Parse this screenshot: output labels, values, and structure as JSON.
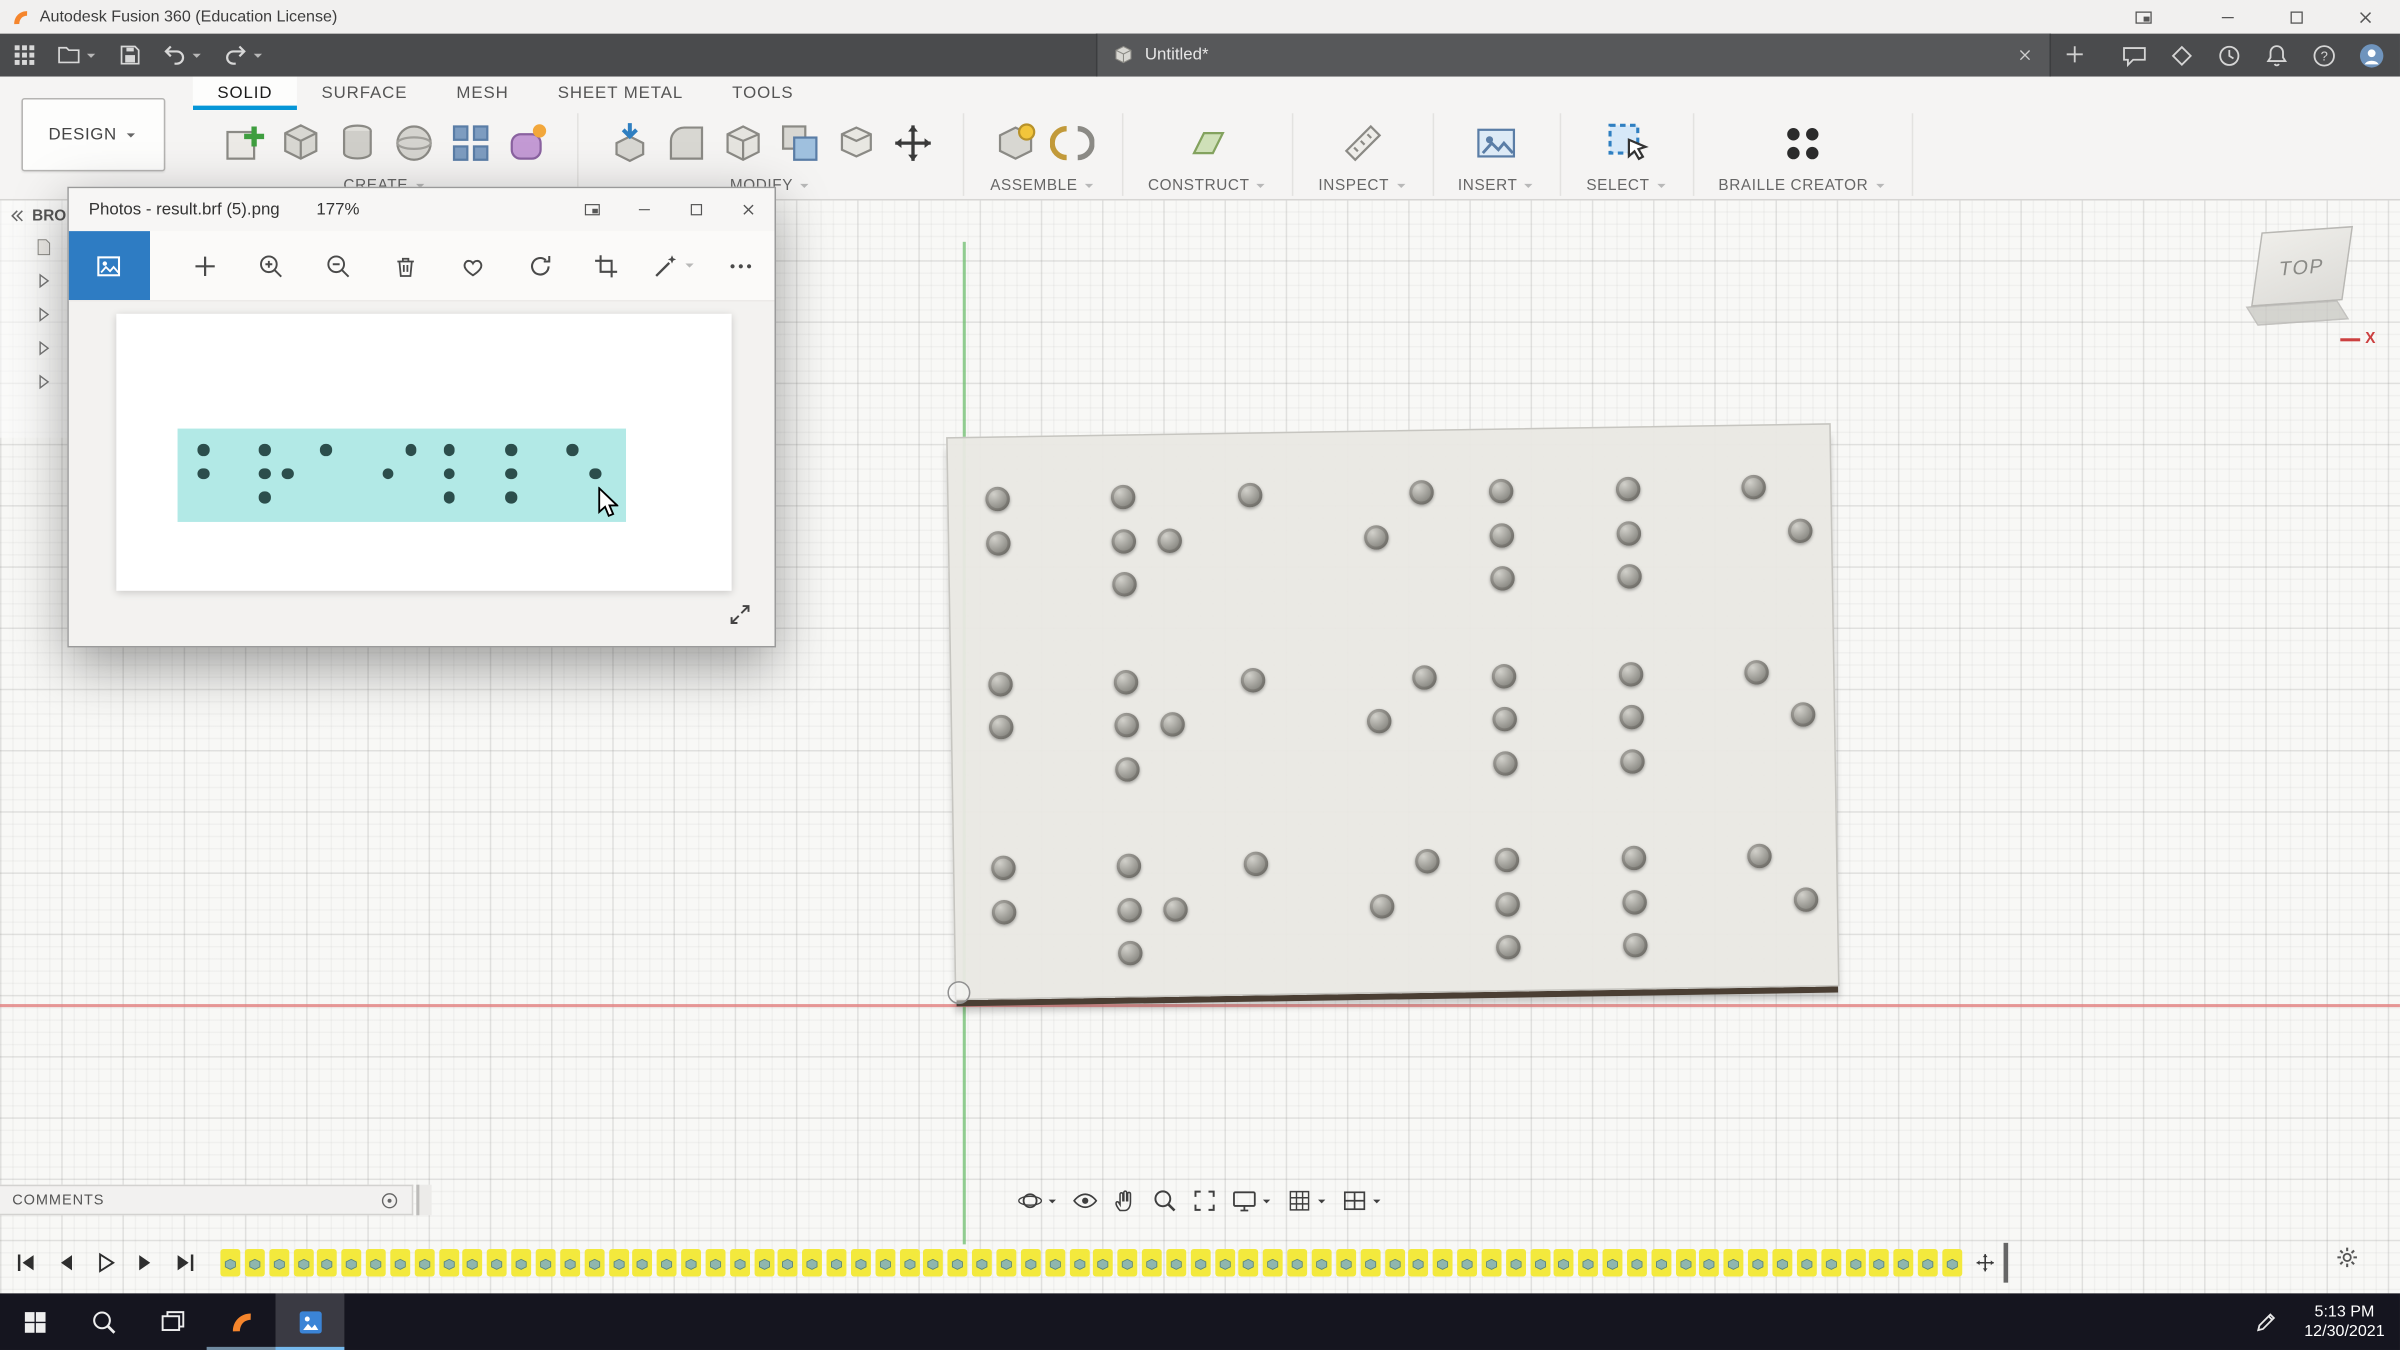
{
  "colors": {
    "accent_blue": "#0696d7",
    "photos_accent": "#2e7cc3",
    "timeline_highlight": "#f3e93d",
    "braille_image_bg": "#b2e9e6",
    "braille_image_dot": "#2c4e4c",
    "plate_fill": "#e9e8e3",
    "fusion_orange": "#f5852c",
    "taskbar_bg": "#15151f"
  },
  "titlebar": {
    "app_title": "Autodesk Fusion 360 (Education License)"
  },
  "tabbar": {
    "qat": [
      {
        "name": "apps-grid",
        "caret": false
      },
      {
        "name": "file",
        "caret": true
      },
      {
        "name": "save",
        "caret": false
      },
      {
        "name": "undo",
        "caret": true
      },
      {
        "name": "redo",
        "caret": true
      }
    ],
    "document_tab": {
      "label": "Untitled*"
    },
    "right_icons": [
      "comment",
      "job-status",
      "clock",
      "notifications",
      "help",
      "avatar"
    ]
  },
  "ribbon": {
    "design_button": "DESIGN",
    "tabs": [
      {
        "label": "SOLID",
        "active": true
      },
      {
        "label": "SURFACE",
        "active": false
      },
      {
        "label": "MESH",
        "active": false
      },
      {
        "label": "SHEET METAL",
        "active": false
      },
      {
        "label": "TOOLS",
        "active": false
      }
    ],
    "groups": [
      {
        "label": "CREATE",
        "icons": [
          "create-sketch",
          "box",
          "cylinder",
          "sphere",
          "pattern",
          "create-form"
        ]
      },
      {
        "label": "MODIFY",
        "icons": [
          "press-pull",
          "fillet",
          "shell",
          "combine",
          "offset-face",
          "move-copy"
        ]
      },
      {
        "label": "ASSEMBLE",
        "icons": [
          "new-component",
          "joint"
        ]
      },
      {
        "label": "CONSTRUCT",
        "icons": [
          "construction-plane"
        ]
      },
      {
        "label": "INSPECT",
        "icons": [
          "measure"
        ]
      },
      {
        "label": "INSERT",
        "icons": [
          "insert-image"
        ]
      },
      {
        "label": "SELECT",
        "icons": [
          "select-window"
        ]
      },
      {
        "label": "BRAILLE CREATOR",
        "icons": [
          "braille-dots"
        ]
      }
    ]
  },
  "browser": {
    "label": "BRO",
    "expand_arrows": 4
  },
  "photos": {
    "title": "Photos - result.brf (5).png",
    "zoom": "177%",
    "toolbar": [
      {
        "name": "see-all-photos",
        "icon": "view-photo",
        "active": true
      },
      {
        "name": "add-to",
        "icon": "plus"
      },
      {
        "name": "zoom-in",
        "icon": "zoom-in"
      },
      {
        "name": "zoom-out",
        "icon": "zoom-out"
      },
      {
        "name": "delete",
        "icon": "delete"
      },
      {
        "name": "favorite",
        "icon": "favorite"
      },
      {
        "name": "rotate",
        "icon": "rotate"
      },
      {
        "name": "crop",
        "icon": "crop"
      },
      {
        "name": "edit",
        "icon": "edit",
        "caret": true
      },
      {
        "name": "more",
        "icon": "more"
      }
    ]
  },
  "viewport": {
    "viewcube_face": "TOP",
    "axis_x_label": "X",
    "comments_label": "COMMENTS",
    "navbar": [
      {
        "name": "orbit",
        "caret": true
      },
      {
        "name": "look-at",
        "caret": false
      },
      {
        "name": "pan",
        "caret": false
      },
      {
        "name": "zoom",
        "caret": false
      },
      {
        "name": "fit",
        "caret": false
      },
      {
        "name": "display-settings",
        "caret": true
      },
      {
        "name": "grid-snaps",
        "caret": true
      },
      {
        "name": "viewports",
        "caret": true
      }
    ]
  },
  "braille": {
    "word": "braille",
    "letters": [
      "b",
      "r",
      "a",
      "i",
      "l",
      "l",
      "e"
    ],
    "patterns": {
      "b": [
        1,
        2
      ],
      "r": [
        1,
        2,
        3,
        5
      ],
      "a": [
        1
      ],
      "i": [
        2,
        4
      ],
      "l": [
        1,
        2,
        3
      ],
      "e": [
        1,
        5
      ]
    },
    "plate_rows": 3,
    "image_rows": 1
  },
  "timeline": {
    "feature_count": 72,
    "controls": [
      "skip-start",
      "step-back",
      "play",
      "step-fwd",
      "skip-end"
    ]
  },
  "taskbar": {
    "apps": [
      {
        "name": "start"
      },
      {
        "name": "search"
      },
      {
        "name": "task-view"
      },
      {
        "name": "fusion-360",
        "running": true
      },
      {
        "name": "photos",
        "active": true
      }
    ],
    "time": "5:13 PM",
    "date": "12/30/2021"
  }
}
